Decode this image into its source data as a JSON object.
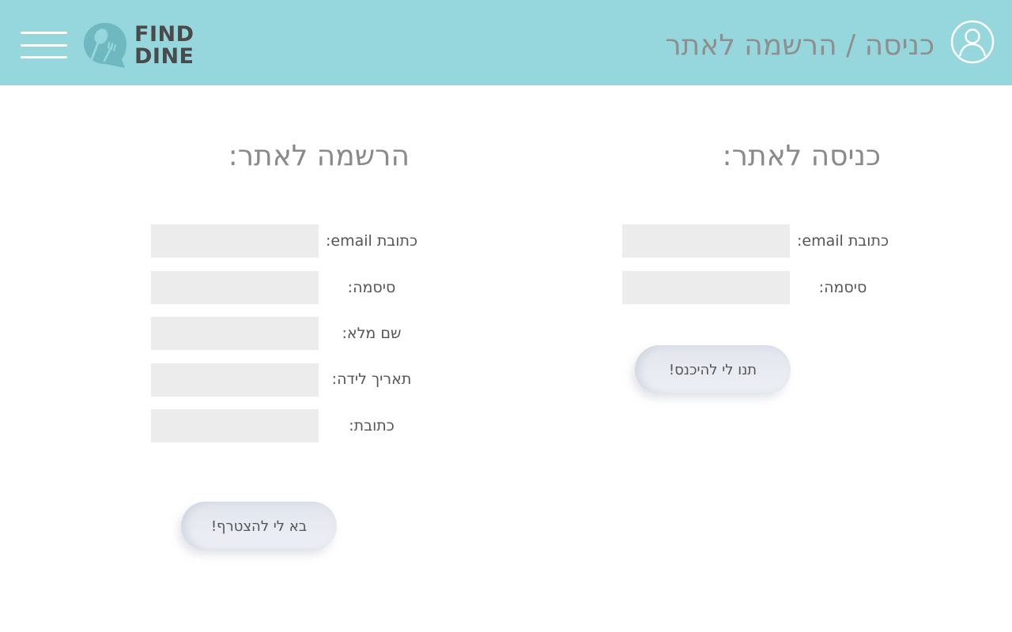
{
  "brand": {
    "logo_line1": "FIND",
    "logo_line2": "DINE"
  },
  "header": {
    "title": "כניסה / הרשמה לאתר",
    "menu_icon": "hamburger-icon",
    "user_icon": "user-icon"
  },
  "colors": {
    "header_bg": "#95d7dc",
    "input_bg": "#ececec",
    "title_text": "#8f8f8f",
    "logo_mark": "#6fb8bf"
  },
  "login": {
    "title": "כניסה לאתר:",
    "fields": [
      {
        "label": "כתובת email:",
        "value": ""
      },
      {
        "label": "סיסמה:",
        "value": ""
      }
    ],
    "submit_label": "תנו לי להיכנס!"
  },
  "register": {
    "title": "הרשמה לאתר:",
    "fields": [
      {
        "label": "כתובת email:",
        "value": ""
      },
      {
        "label": "סיסמה:",
        "value": ""
      },
      {
        "label": "שם מלא:",
        "value": ""
      },
      {
        "label": "תאריך לידה:",
        "value": ""
      },
      {
        "label": "כתובת:",
        "value": ""
      }
    ],
    "submit_label": "בא לי להצטרף!"
  }
}
